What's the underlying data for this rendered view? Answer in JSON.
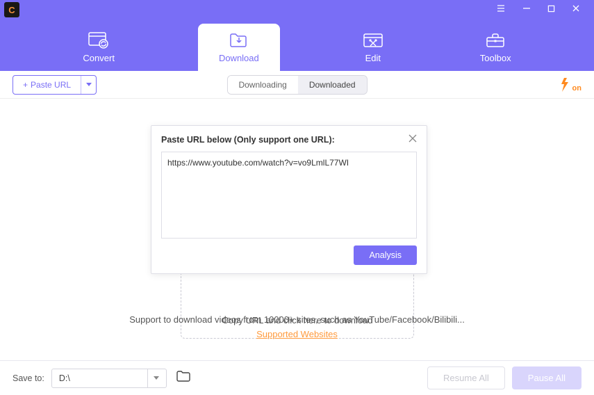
{
  "logo_letter": "C",
  "tabs": {
    "convert": "Convert",
    "download": "Download",
    "edit": "Edit",
    "toolbox": "Toolbox"
  },
  "paste_button": "Paste URL",
  "segments": {
    "downloading": "Downloading",
    "downloaded": "Downloaded"
  },
  "dialog": {
    "title": "Paste URL below (Only support one URL):",
    "url_value": "https://www.youtube.com/watch?v=vo9LmlL77WI",
    "analysis": "Analysis"
  },
  "drop_text": "Copy URL and click here to download",
  "support_line": "Support to download videos from 10000+ sites, such as YouTube/Facebook/Bilibili...",
  "supported_link": "Supported Websites",
  "footer": {
    "save_to": "Save to:",
    "path": "D:\\",
    "resume": "Resume All",
    "pause": "Pause All"
  },
  "brand_on": "on"
}
